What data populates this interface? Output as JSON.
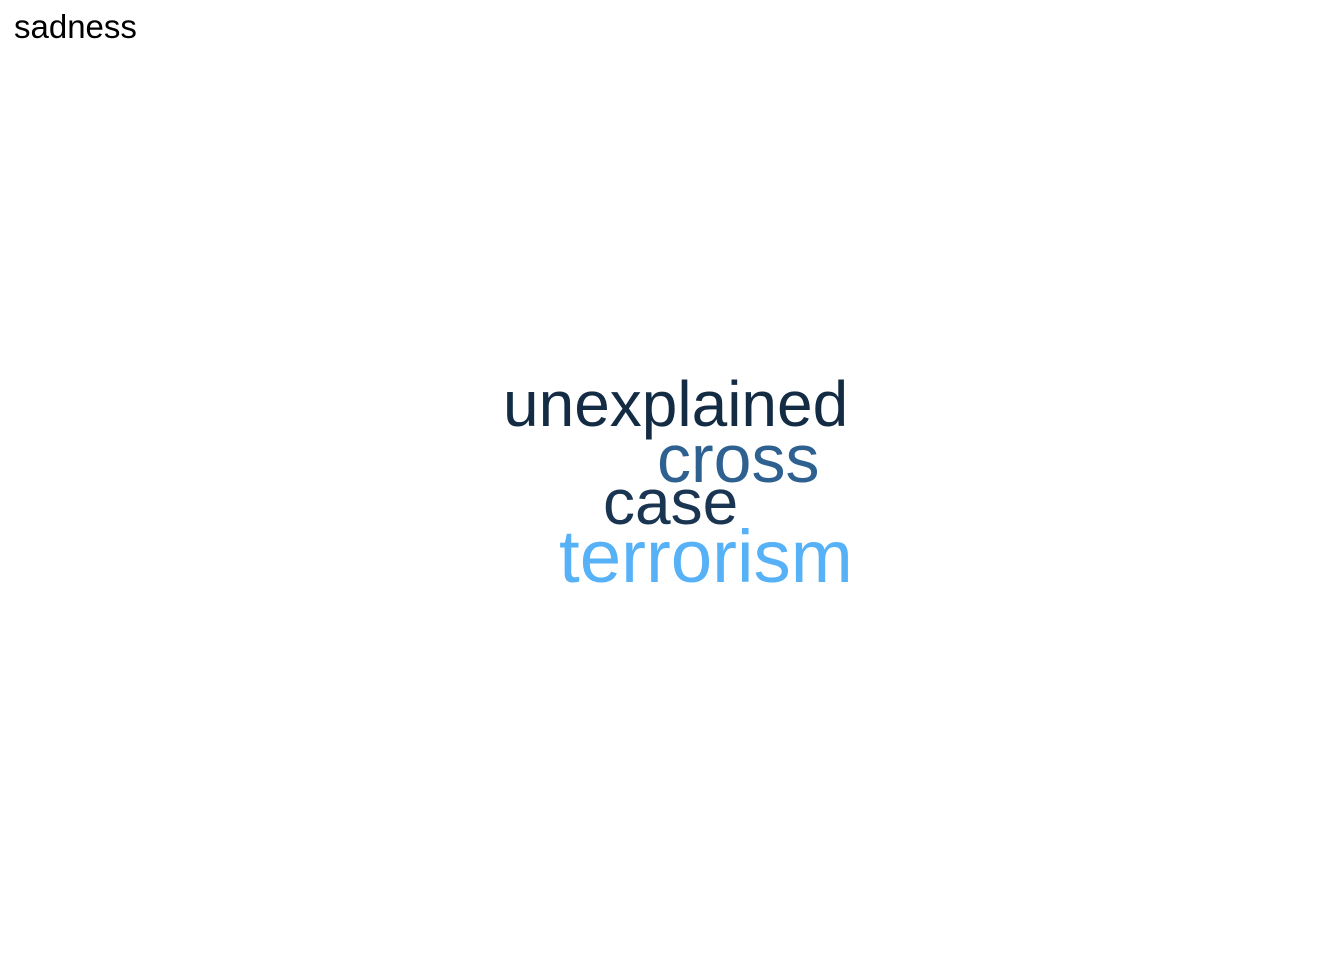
{
  "chart_data": {
    "type": "wordcloud",
    "title": "sadness",
    "color_scale": {
      "low": "#132B43",
      "high": "#56B1F7"
    },
    "words": [
      {
        "text": "unexplained",
        "color": "#132B43"
      },
      {
        "text": "cross",
        "color": "#2E6190"
      },
      {
        "text": "case",
        "color": "#1A3551"
      },
      {
        "text": "terrorism",
        "color": "#56B1F7"
      }
    ]
  }
}
